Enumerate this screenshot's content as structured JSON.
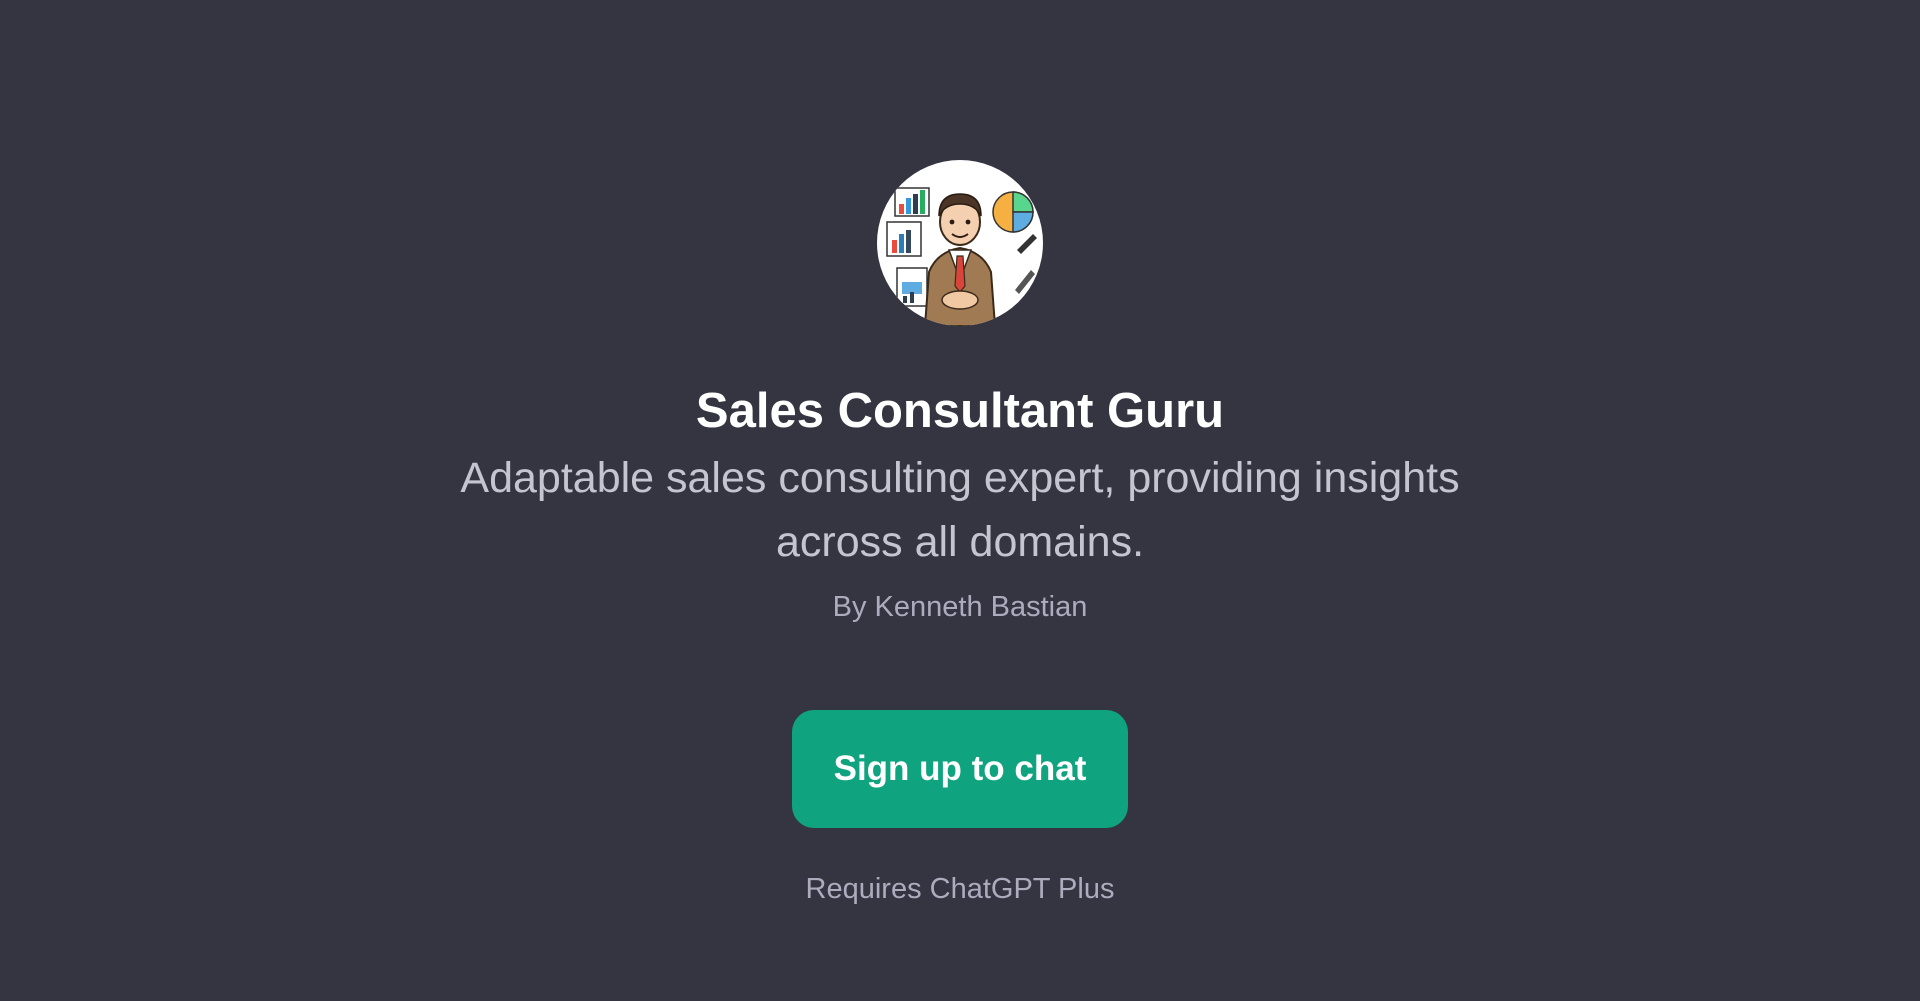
{
  "gpt": {
    "name": "Sales Consultant Guru",
    "description": "Adaptable sales consulting expert, providing insights across all domains.",
    "author": "By Kenneth Bastian",
    "avatar_icon": "sales-consultant-avatar"
  },
  "actions": {
    "signup_label": "Sign up to chat",
    "requirement_note": "Requires ChatGPT Plus"
  },
  "colors": {
    "background": "#343541",
    "accent": "#10a37f",
    "title": "#ffffff",
    "description": "#c5c5d2",
    "muted": "#acacbe"
  }
}
